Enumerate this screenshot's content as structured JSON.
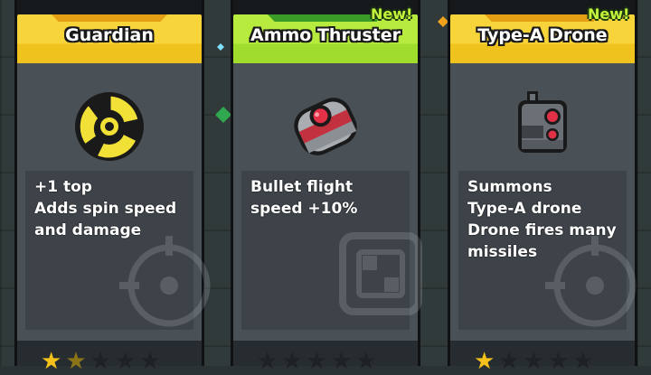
{
  "cards": [
    {
      "title": "Guardian",
      "description": "+1 top\nAdds spin speed\nand damage",
      "icon": "shuriken-icon",
      "header_color": "#f7d43a",
      "is_new": false,
      "stars_filled": 1,
      "stars_total": 5
    },
    {
      "title": "Ammo Thruster",
      "description": "Bullet flight\nspeed +10%",
      "icon": "thruster-icon",
      "header_color": "#b7ec3e",
      "is_new": true,
      "new_label": "New!",
      "stars_filled": 0,
      "stars_total": 5
    },
    {
      "title": "Type-A Drone",
      "description": "Summons\nType-A drone\nDrone fires many\nmissiles",
      "icon": "drone-icon",
      "header_color": "#f7d43a",
      "is_new": true,
      "new_label": "New!",
      "stars_filled": 1,
      "stars_total": 5
    }
  ]
}
